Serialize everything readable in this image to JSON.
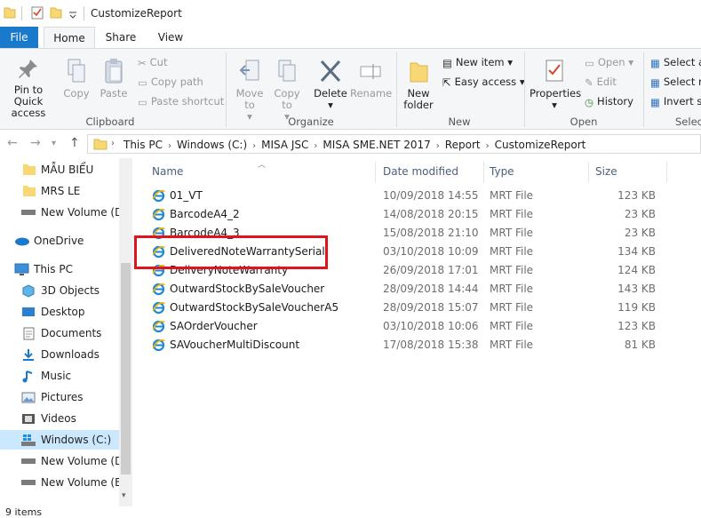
{
  "window": {
    "title": "CustomizeReport"
  },
  "tabs": [
    {
      "label": "File"
    },
    {
      "label": "Home"
    },
    {
      "label": "Share"
    },
    {
      "label": "View"
    }
  ],
  "ribbon": {
    "clipboard": {
      "group_label": "Clipboard",
      "pin": "Pin to Quick access",
      "copy": "Copy",
      "paste": "Paste",
      "cut": "Cut",
      "copy_path": "Copy path",
      "paste_shortcut": "Paste shortcut"
    },
    "organize": {
      "group_label": "Organize",
      "move_to": "Move to",
      "copy_to": "Copy to",
      "delete": "Delete",
      "rename": "Rename"
    },
    "new": {
      "group_label": "New",
      "new_folder": "New folder",
      "new_item": "New item",
      "easy_access": "Easy access"
    },
    "open": {
      "group_label": "Open",
      "properties": "Properties",
      "open": "Open",
      "edit": "Edit",
      "history": "History"
    },
    "select": {
      "group_label": "Selec",
      "select_all": "Select a",
      "select_none": "Select n",
      "invert": "Invert s"
    }
  },
  "address": {
    "crumbs": [
      "This PC",
      "Windows (C:)",
      "MISA JSC",
      "MISA SME.NET 2017",
      "Report",
      "CustomizeReport"
    ]
  },
  "nav": {
    "items": [
      {
        "label": "MẪU BIỂU",
        "icon": "folder-icon"
      },
      {
        "label": "MRS LE",
        "icon": "folder-icon"
      },
      {
        "label": "New Volume (D:",
        "icon": "drive-icon"
      },
      {
        "label": "OneDrive",
        "icon": "cloud-icon"
      },
      {
        "label": "This PC",
        "icon": "computer-icon"
      },
      {
        "label": "3D Objects",
        "icon": "cube-icon"
      },
      {
        "label": "Desktop",
        "icon": "desktop-icon"
      },
      {
        "label": "Documents",
        "icon": "documents-icon"
      },
      {
        "label": "Downloads",
        "icon": "download-icon"
      },
      {
        "label": "Music",
        "icon": "music-icon"
      },
      {
        "label": "Pictures",
        "icon": "pictures-icon"
      },
      {
        "label": "Videos",
        "icon": "videos-icon"
      },
      {
        "label": "Windows (C:)",
        "icon": "windows-drive-icon"
      },
      {
        "label": "New Volume (D:",
        "icon": "drive-icon"
      },
      {
        "label": "New Volume (E:)",
        "icon": "drive-icon"
      }
    ]
  },
  "columns": {
    "name": "Name",
    "date": "Date modified",
    "type": "Type",
    "size": "Size"
  },
  "files": [
    {
      "name": "01_VT",
      "date": "10/09/2018 14:55",
      "type": "MRT File",
      "size": "123 KB"
    },
    {
      "name": "BarcodeA4_2",
      "date": "14/08/2018 20:15",
      "type": "MRT File",
      "size": "23 KB"
    },
    {
      "name": "BarcodeA4_3",
      "date": "15/08/2018 21:10",
      "type": "MRT File",
      "size": "23 KB"
    },
    {
      "name": "DeliveredNoteWarrantySerial",
      "date": "03/10/2018 10:09",
      "type": "MRT File",
      "size": "134 KB"
    },
    {
      "name": "DeliveryNoteWarranty",
      "date": "26/09/2018 17:01",
      "type": "MRT File",
      "size": "124 KB"
    },
    {
      "name": "OutwardStockBySaleVoucher",
      "date": "28/09/2018 14:44",
      "type": "MRT File",
      "size": "143 KB"
    },
    {
      "name": "OutwardStockBySaleVoucherA5",
      "date": "28/09/2018 15:07",
      "type": "MRT File",
      "size": "119 KB"
    },
    {
      "name": "SAOrderVoucher",
      "date": "03/10/2018 10:06",
      "type": "MRT File",
      "size": "123 KB"
    },
    {
      "name": "SAVoucherMultiDiscount",
      "date": "17/08/2018 15:38",
      "type": "MRT File",
      "size": "81 KB"
    }
  ],
  "status": {
    "items": "9 items"
  },
  "colors": {
    "accent": "#1979ca",
    "selection": "#cce8ff",
    "highlight": "#e0141b"
  }
}
